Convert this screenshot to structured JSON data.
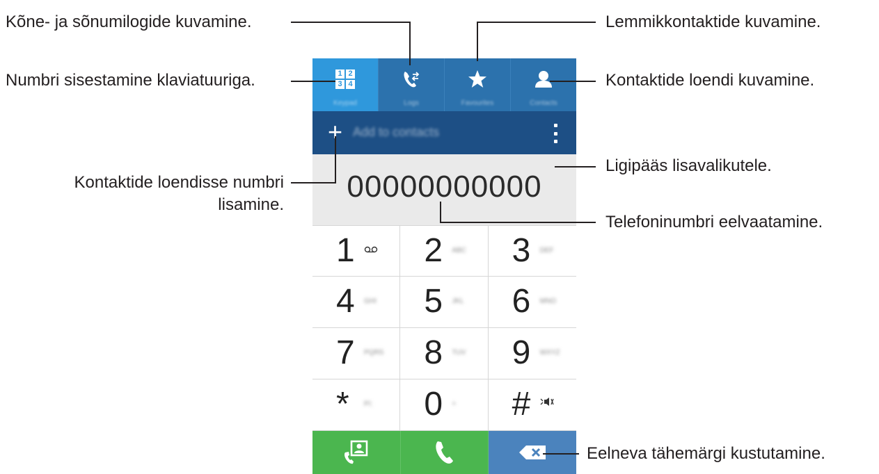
{
  "tabs": [
    {
      "icon": "keypad-icon",
      "label": "Keypad",
      "active": true
    },
    {
      "icon": "logs-icon",
      "label": "Logs",
      "active": false
    },
    {
      "icon": "star-icon",
      "label": "Favourites",
      "active": false
    },
    {
      "icon": "contact-icon",
      "label": "Contacts",
      "active": false
    }
  ],
  "actionbar": {
    "add_label": "Add to contacts",
    "add_icon": "plus-icon",
    "more_icon": "more-options-icon"
  },
  "number_display": "00000000000",
  "keys": [
    {
      "digit": "1",
      "letters": "",
      "icon": "voicemail-icon"
    },
    {
      "digit": "2",
      "letters": "ABC"
    },
    {
      "digit": "3",
      "letters": "DEF"
    },
    {
      "digit": "4",
      "letters": "GHI"
    },
    {
      "digit": "5",
      "letters": "JKL"
    },
    {
      "digit": "6",
      "letters": "MNO"
    },
    {
      "digit": "7",
      "letters": "PQRS"
    },
    {
      "digit": "8",
      "letters": "TUV"
    },
    {
      "digit": "9",
      "letters": "WXYZ"
    },
    {
      "digit": "*",
      "letters": "P/;"
    },
    {
      "digit": "0",
      "letters": "+"
    },
    {
      "digit": "#",
      "letters": "",
      "icon": "mute-icon"
    }
  ],
  "bottom_buttons": {
    "contacts_call_icon": "contact-card-call-icon",
    "call_icon": "phone-icon",
    "backspace_icon": "backspace-icon",
    "green": "#4bb64f",
    "blue": "#4b83bd"
  },
  "callouts": {
    "logs": "Kõne- ja sõnumilogide kuvamine.",
    "keypad": "Numbri sisestamine klaviatuuriga.",
    "favourites": "Lemmikkontaktide kuvamine.",
    "contacts": "Kontaktide loendi kuvamine.",
    "add_line1": "Kontaktide loendisse numbri",
    "add_line2": "lisamine.",
    "more": "Ligipääs lisavalikutele.",
    "preview": "Telefoninumbri eelvaatamine.",
    "delete": "Eelneva tähemärgi kustutamine."
  },
  "colors": {
    "tab_bar": "#2c72ad",
    "tab_active": "#2f98dc",
    "action_bar": "#1d4f85",
    "number_bg": "#eaeaea"
  }
}
